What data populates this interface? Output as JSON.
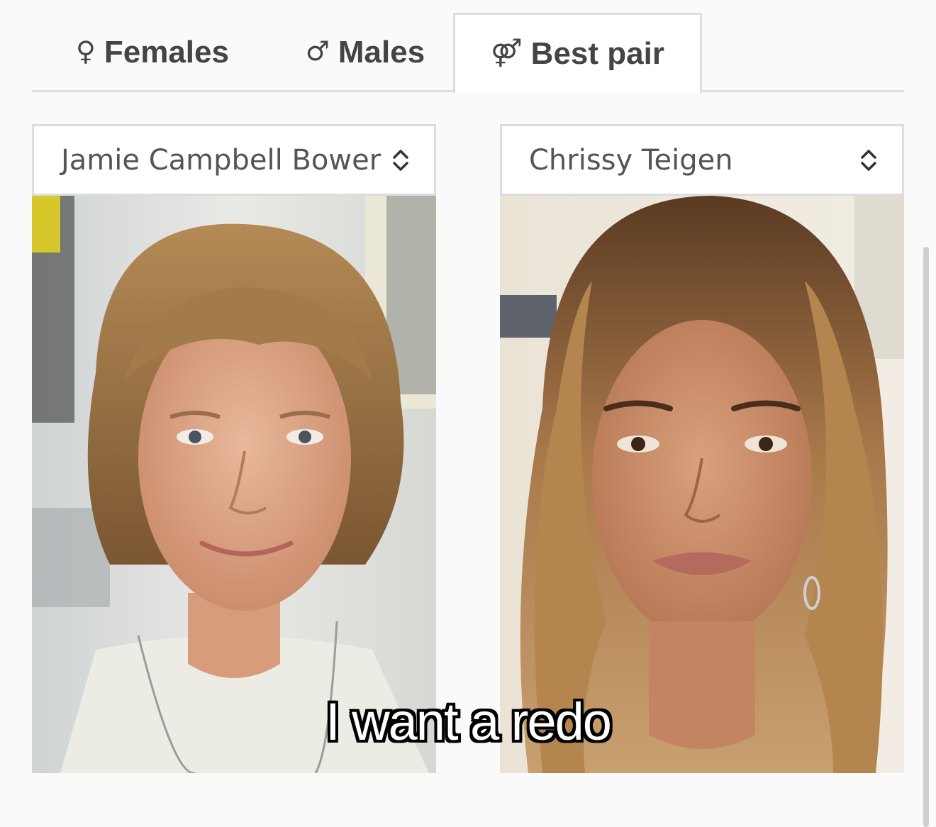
{
  "tabs": [
    {
      "symbol": "♀",
      "label": "Females"
    },
    {
      "symbol": "♂",
      "label": "Males"
    },
    {
      "symbol": "⚤",
      "label": "Best pair"
    }
  ],
  "active_tab": "Best pair",
  "left_select": {
    "value": "Jamie Campbell Bower"
  },
  "right_select": {
    "value": "Chrissy Teigen"
  },
  "caption": "I want a redo",
  "colors": {
    "background": "#fafafa",
    "border": "#dedede",
    "tab_text": "#444444",
    "select_text": "#555555"
  },
  "icons": [
    "female-icon",
    "male-icon",
    "pair-icon",
    "chevron-updown-icon"
  ]
}
